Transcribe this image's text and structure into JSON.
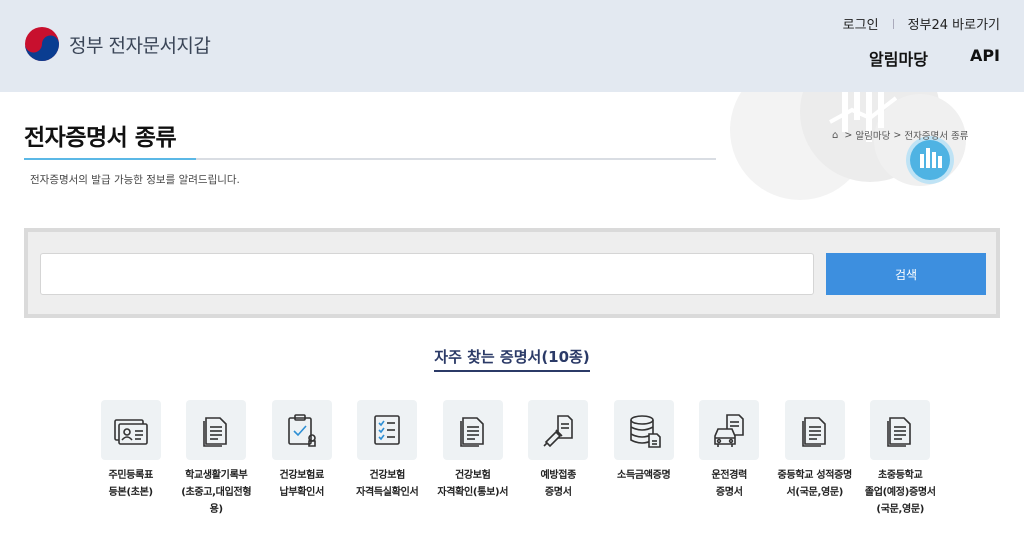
{
  "header": {
    "logo_text": "정부 전자문서지갑",
    "login": "로그인",
    "gov24": "정부24 바로가기",
    "nav": [
      "알림마당",
      "API"
    ]
  },
  "page": {
    "title": "전자증명서 종류",
    "breadcrumb": [
      "알림마당",
      "전자증명서 종류"
    ],
    "description": "전자증명서의 발급 가능한 정보를 알려드립니다."
  },
  "search": {
    "value": "",
    "placeholder": "",
    "button": "검색"
  },
  "frequent": {
    "title": "자주 찾는 증명서(10종)",
    "items": [
      {
        "label": "주민등록표\n등본(초본)",
        "icon": "id-card-icon"
      },
      {
        "label": "학교생활기록부\n(초중고,대입전형\n용)",
        "icon": "document-icon"
      },
      {
        "label": "건강보험료\n납부확인서",
        "icon": "clipboard-check-icon"
      },
      {
        "label": "건강보험\n자격득실확인서",
        "icon": "checklist-icon"
      },
      {
        "label": "건강보험\n자격확인(통보)서",
        "icon": "document-icon"
      },
      {
        "label": "예방접종\n증명서",
        "icon": "syringe-icon"
      },
      {
        "label": "소득금액증명",
        "icon": "database-icon"
      },
      {
        "label": "운전경력\n증명서",
        "icon": "car-document-icon"
      },
      {
        "label": "중등학교 성적증명\n서(국문,영문)",
        "icon": "document-icon"
      },
      {
        "label": "초중등학교\n졸업(예정)증명서\n(국문,영문)",
        "icon": "document-icon"
      }
    ]
  },
  "colors": {
    "header_bg": "#e3e9f1",
    "accent_blue": "#3d8fdf",
    "title_accent": "#5bb8e6",
    "navy": "#2b3a67"
  }
}
